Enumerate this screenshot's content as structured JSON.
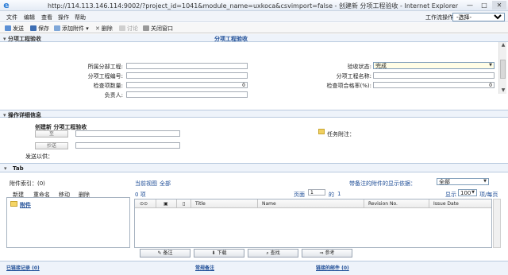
{
  "window": {
    "title": "http://114.113.146.114:9002/?project_id=1041&module_name=uxkoca&csvimport=false - 创建新 分项工程验收 - Internet Explorer",
    "controls": [
      "—",
      "□",
      "✕"
    ]
  },
  "menu": {
    "items": [
      "文件",
      "编辑",
      "查看",
      "操作",
      "帮助"
    ],
    "workflow_label": "工作流操作",
    "workflow_value": "-选择-"
  },
  "toolbar": {
    "send": "发送",
    "save": "保存",
    "add_attachment": "添加附件",
    "delete": "删除",
    "discuss": "讨论",
    "close": "关闭窗口"
  },
  "form": {
    "section_label": "分项工程验收",
    "section_title": "分项工程验收",
    "fields": {
      "sub_project_label": "所属分部工程:",
      "sub_project_value": "",
      "item_no_label": "分项工程编号:",
      "item_no_value": "",
      "check_count_label": "检查项数量:",
      "check_count_value": "0",
      "owner_label": "负责人:",
      "owner_value": "",
      "status_label": "验收状态:",
      "status_value": "完成",
      "item_name_label": "分项工程名称:",
      "item_name_value": "",
      "pass_rate_label": "检查项合格率(%):",
      "pass_rate_value": "0"
    }
  },
  "detail": {
    "section_label": "操作详细信息",
    "create_title": "创建新 分项工程验收",
    "btn1": "至",
    "btn2": "抄送",
    "send_to_label": "发送以供：",
    "task_note_label": "任务附注："
  },
  "tab": {
    "label": "Tab",
    "attachment_index": "附件索引：(0)",
    "current_view_label": "当前视图",
    "current_view_value": "全部",
    "count_text": "0 项",
    "filter_label": "带备注的附件的显示依据：",
    "filter_value": "全部",
    "page_label": "页面",
    "page_value": "1",
    "of_label": "的",
    "total_pages": "1",
    "show_label": "显示",
    "show_value": "100",
    "per_page_label": "项/每页",
    "left_actions": [
      "新建",
      "重命名",
      "移动",
      "删除"
    ],
    "folder_label": "附件",
    "columns": [
      "Title",
      "Name",
      "Revision No.",
      "Issue Date"
    ],
    "bottom_buttons": [
      "备注",
      "下载",
      "查找",
      "参考"
    ]
  },
  "status": {
    "tracked": "已链接记录 (0)",
    "notes": "常规备注",
    "mails": "链接的邮件 (0)"
  }
}
